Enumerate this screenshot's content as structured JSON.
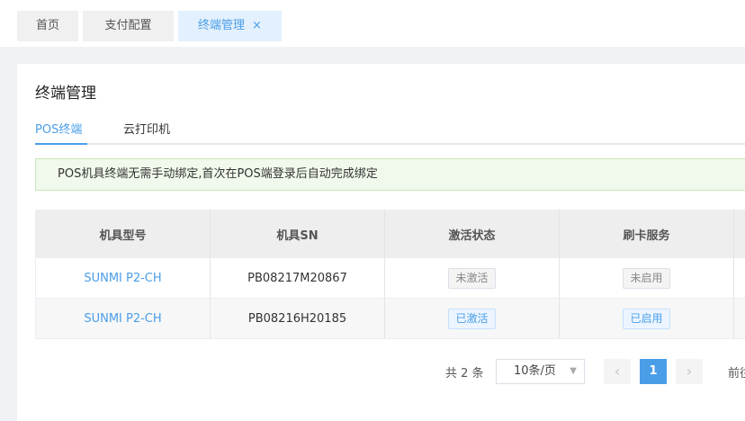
{
  "tabs": [
    {
      "label": "首页"
    },
    {
      "label": "支付配置"
    },
    {
      "label": "终端管理",
      "close": "×"
    }
  ],
  "page_title": "终端管理",
  "subtabs": [
    {
      "label": "POS终端"
    },
    {
      "label": "云打印机"
    }
  ],
  "notice": "POS机具终端无需手动绑定,首次在POS端登录后自动完成绑定",
  "table": {
    "headers": [
      "机具型号",
      "机具SN",
      "激活状态",
      "刷卡服务"
    ],
    "rows": [
      {
        "model": "SUNMI P2-CH",
        "sn": "PB08217M20867",
        "activation": "未激活",
        "card_service": "未启用"
      },
      {
        "model": "SUNMI P2-CH",
        "sn": "PB08216H20185",
        "activation": "已激活",
        "card_service": "已启用"
      }
    ]
  },
  "pagination": {
    "total": "共 2 条",
    "page_size": "10条/页",
    "prev_icon": "‹",
    "current_page": "1",
    "next_icon": "›",
    "goto": "前往"
  },
  "colors": {
    "accent": "#4a9ee8",
    "notice_bg": "#f0f9eb"
  }
}
